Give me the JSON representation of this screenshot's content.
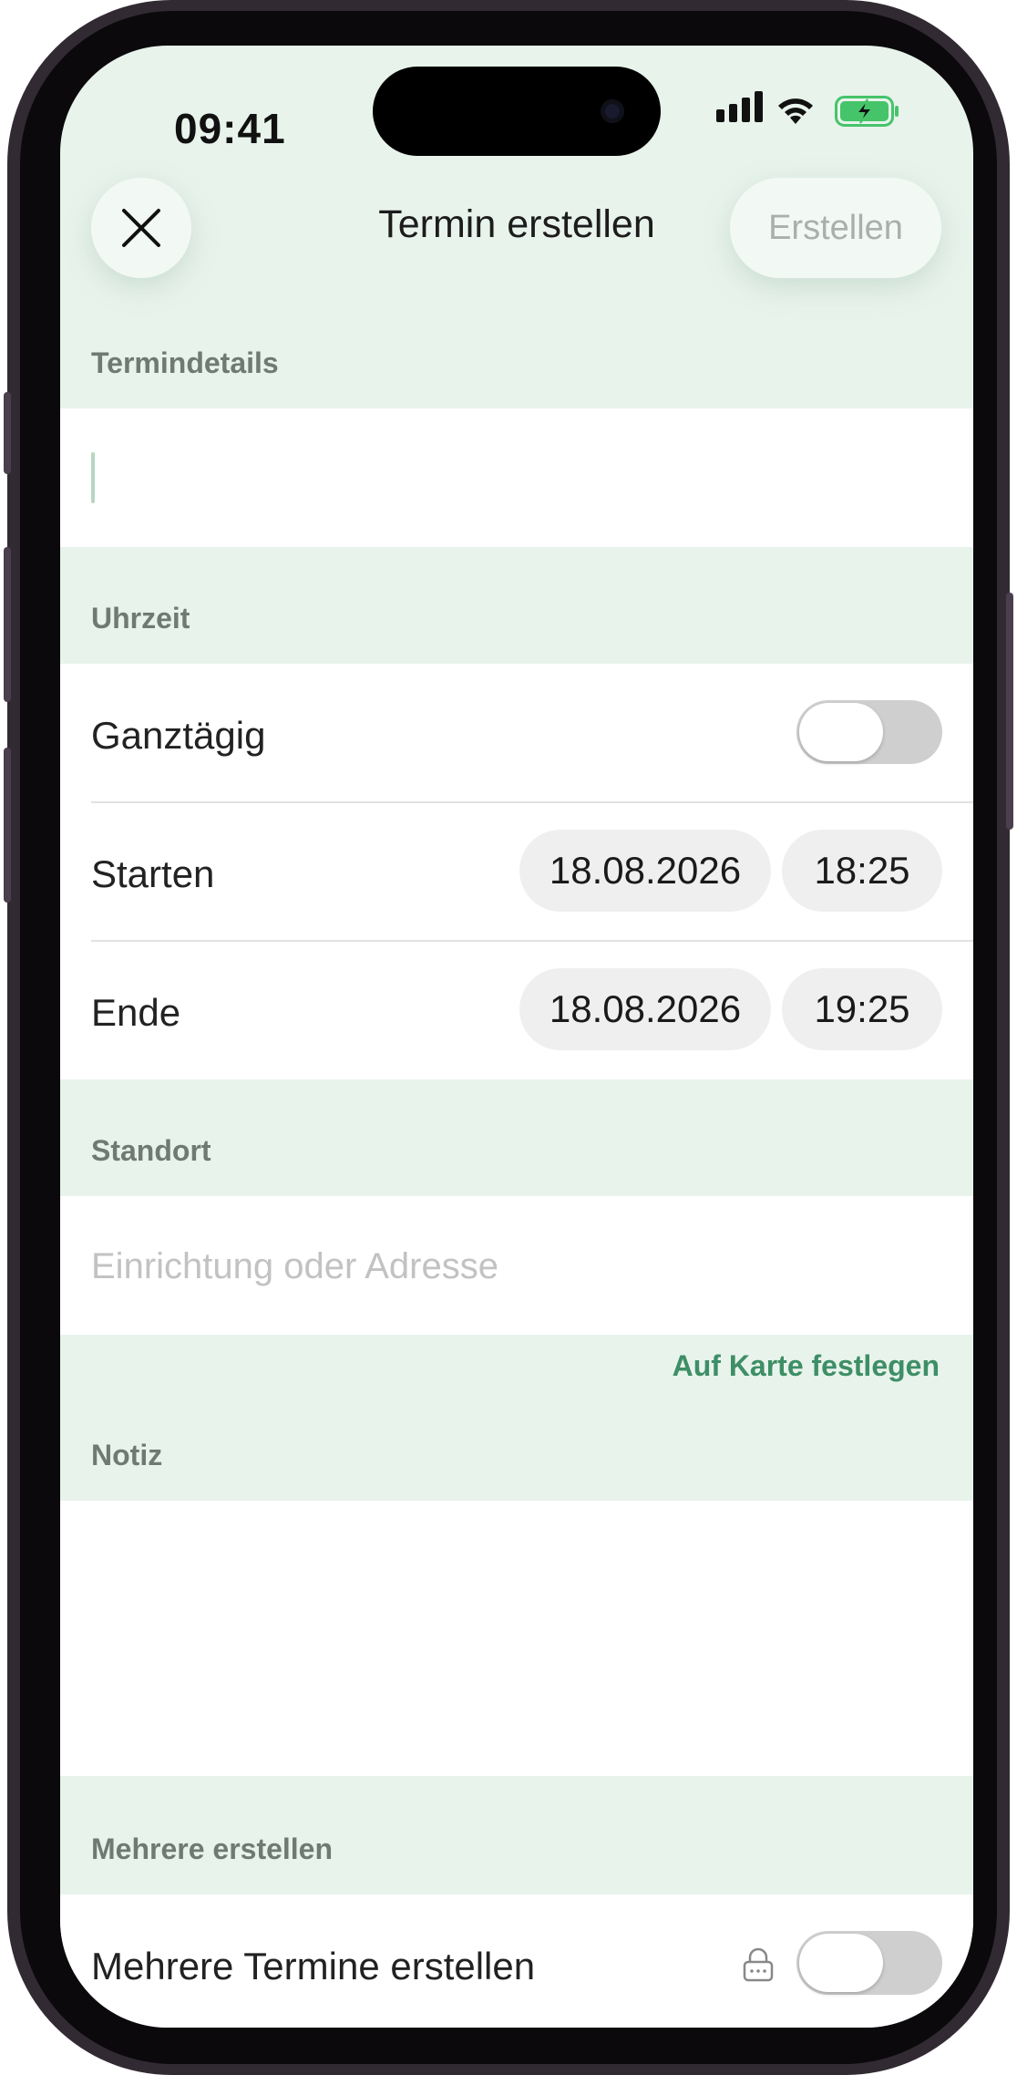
{
  "status_bar": {
    "time": "09:41"
  },
  "header": {
    "title": "Termin erstellen",
    "create_label": "Erstellen"
  },
  "sections": {
    "details": {
      "heading": "Termindetails",
      "title_value": ""
    },
    "time": {
      "heading": "Uhrzeit",
      "all_day_label": "Ganztägig",
      "start_label": "Starten",
      "start_date": "18.08.2026",
      "start_time": "18:25",
      "end_label": "Ende",
      "end_date": "18.08.2026",
      "end_time": "19:25"
    },
    "location": {
      "heading": "Standort",
      "placeholder": "Einrichtung oder Adresse",
      "map_link": "Auf Karte festlegen"
    },
    "note": {
      "heading": "Notiz"
    },
    "multiple": {
      "heading": "Mehrere erstellen",
      "label": "Mehrere Termine erstellen"
    }
  },
  "colors": {
    "accent": "#3e8e66",
    "section_bg": "#e8f3ec",
    "toggle_off": "#cfcfcf"
  }
}
